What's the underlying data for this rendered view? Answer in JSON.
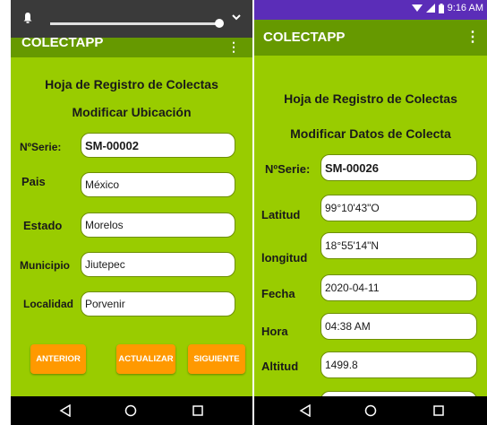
{
  "colors": {
    "background": "#99cc00",
    "app_bar": "#669900",
    "status_bar": "#5b2db8",
    "button": "#ff9900",
    "nav_bar": "#000000"
  },
  "left_screen": {
    "shade": {
      "icons": [
        "bell-icon",
        "brightness-slider",
        "chevron-down-icon"
      ]
    },
    "app_title": "COLECTAPP",
    "menu_icon": "⋮",
    "heading": "Hoja de Registro de Colectas",
    "subheading": "Modificar Ubicación",
    "fields": [
      {
        "label": "NºSerie:",
        "value": "SM-00002"
      },
      {
        "label": "Pais",
        "value": "México"
      },
      {
        "label": "Estado",
        "value": "Morelos"
      },
      {
        "label": "Municipio",
        "value": "Jiutepec"
      },
      {
        "label": "Localidad",
        "value": "Porvenir"
      }
    ],
    "buttons": [
      "ANTERIOR",
      "ACTUALIZAR",
      "SIGUIENTE"
    ],
    "nav": [
      "back-icon",
      "home-icon",
      "recents-icon"
    ]
  },
  "right_screen": {
    "status": {
      "time": "9:16 AM",
      "icons": [
        "wifi-icon",
        "signal-icon",
        "battery-icon"
      ]
    },
    "app_title": "COLECTAPP",
    "menu_icon": "⋮",
    "heading": "Hoja de Registro de Colectas",
    "subheading": "Modificar Datos de Colecta",
    "fields": [
      {
        "label": "NºSerie:",
        "value": "SM-00026"
      },
      {
        "label": "Latitud",
        "value": "99°10'43\"O"
      },
      {
        "label": "longitud",
        "value": "18°55'14\"N"
      },
      {
        "label": "Fecha",
        "value": "2020-04-11"
      },
      {
        "label": "Hora",
        "value": "04:38 AM"
      },
      {
        "label": "Altitud",
        "value": "1499.8"
      },
      {
        "label": "",
        "value": ""
      }
    ],
    "nav": [
      "back-icon",
      "home-icon",
      "recents-icon"
    ]
  }
}
